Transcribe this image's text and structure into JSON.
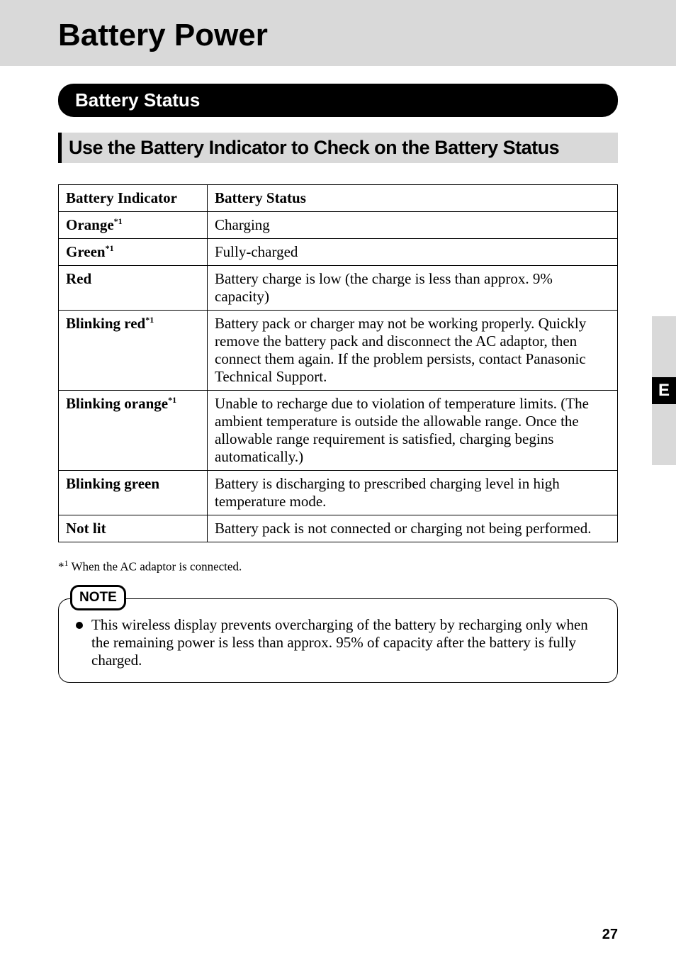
{
  "title": "Battery Power",
  "section_heading": "Battery Status",
  "sub_heading": "Use the Battery Indicator to Check on the Battery Status",
  "table": {
    "header_indicator": "Battery Indicator",
    "header_status": "Battery Status",
    "rows": [
      {
        "indicator": "Orange",
        "sup": "*1",
        "status": "Charging"
      },
      {
        "indicator": "Green",
        "sup": "*1",
        "status": "Fully-charged"
      },
      {
        "indicator": "Red",
        "sup": "",
        "status": "Battery charge is low (the charge is less than approx. 9% capacity)"
      },
      {
        "indicator": "Blinking red",
        "sup": "*1",
        "status": "Battery pack or charger may not be working properly. Quickly remove the battery pack and disconnect the AC adaptor, then connect them again. If the problem persists, contact Panasonic Technical Support."
      },
      {
        "indicator": "Blinking orange",
        "sup": "*1",
        "status": "Unable to recharge due to violation of temperature limits. (The ambient temperature is outside the allowable range. Once the allowable range requirement is satisfied, charging begins automatically.)"
      },
      {
        "indicator": "Blinking green",
        "sup": "",
        "status": "Battery is discharging to prescribed charging level in high temperature mode."
      },
      {
        "indicator": "Not lit",
        "sup": "",
        "status": "Battery pack is not connected or charging not being performed."
      }
    ]
  },
  "footnote_marker": "*",
  "footnote_sup": "1",
  "footnote_text": " When the AC adaptor is connected.",
  "note_label": "NOTE",
  "note_text": "This wireless display prevents overcharging of the battery by recharging only when the remaining power is less than approx. 95% of capacity after the battery is fully charged.",
  "side_tab": "E",
  "page_number": "27"
}
